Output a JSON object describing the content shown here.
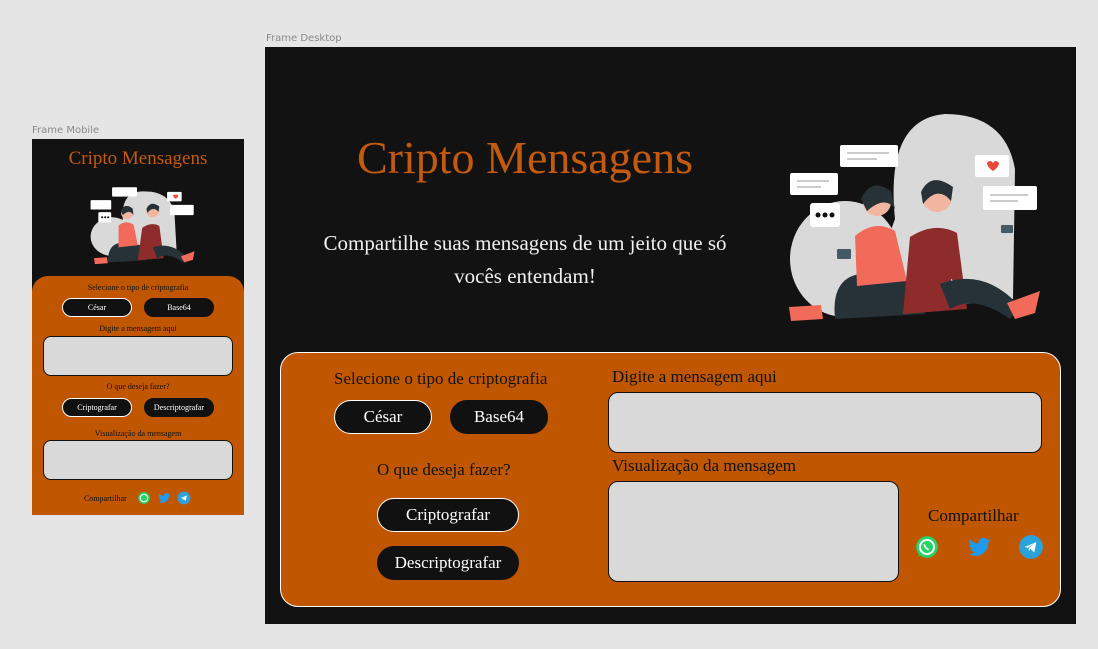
{
  "frames": {
    "mobile_label": "Frame Mobile",
    "desktop_label": "Frame Desktop"
  },
  "app": {
    "title": "Cripto Mensagens",
    "subtitle": "Compartilhe suas mensagens de um jeito que só vocês entendam!"
  },
  "form": {
    "select_label": "Selecione o tipo de criptografia",
    "option_cesar": "César",
    "option_base64": "Base64",
    "message_label": "Digite a mensagem aqui",
    "action_label": "O que deseja fazer?",
    "encrypt_button": "Criptografar",
    "decrypt_button": "Descriptografar",
    "preview_label": "Visualização da mensagem",
    "share_label": "Compartilhar"
  },
  "icons": {
    "whatsapp": "whatsapp-icon",
    "twitter": "twitter-icon",
    "telegram": "telegram-icon"
  },
  "colors": {
    "background": "#121212",
    "accent": "#c05700",
    "title": "#c45a0e",
    "input": "#d9d9d9",
    "whatsapp": "#25d366",
    "twitter": "#1d9bf0",
    "telegram": "#2aa3db"
  }
}
